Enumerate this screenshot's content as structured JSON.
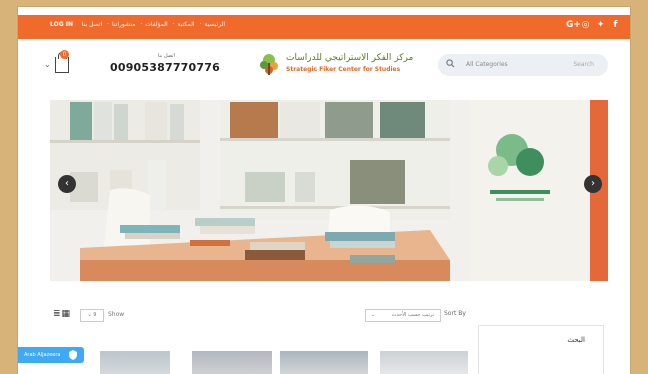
{
  "topbar": {
    "login": "LOG IN",
    "links": [
      "الرئيسية",
      "المكتبة",
      "المؤلفات",
      "منشوراتنا",
      "اتصل بنا"
    ],
    "social_icons": [
      "google-plus-icon",
      "instagram-icon",
      "twitter-icon",
      "facebook-icon"
    ],
    "color": "#f06a2c"
  },
  "header": {
    "phone_label": "اتصل بنا",
    "phone_number": "00905387770776",
    "cart_count": "0",
    "logo_arabic": "مركز الفكر الاستراتيجي للدراسات",
    "logo_english": "Strategic Fiker Center for Studies",
    "search_category": "All Categories",
    "search_placeholder": "Search"
  },
  "slider": {
    "prev_icon": "chevron-left-icon",
    "next_icon": "chevron-right-icon"
  },
  "toolbar": {
    "per_page": "9",
    "show_label": "Show",
    "sort_value": "ترتيب حسب الأحدث",
    "sort_label": "Sort By"
  },
  "sidebar": {
    "title": "البحث"
  },
  "chat": {
    "label": "Arab Aljazeera"
  }
}
